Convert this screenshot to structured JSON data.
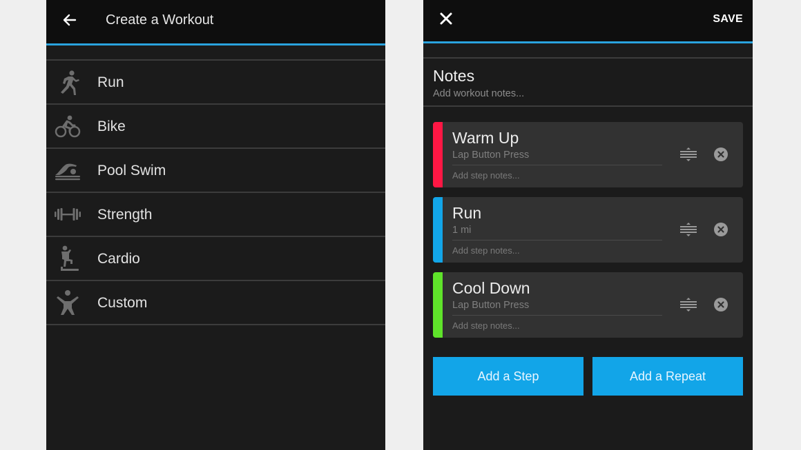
{
  "colors": {
    "accent": "#2aa3de",
    "button": "#12a5e8",
    "step_warmup": "#ff1744",
    "step_run": "#12a5e8",
    "step_cooldown": "#5fe32a"
  },
  "left_screen": {
    "header": {
      "back_icon": "arrow-left-icon",
      "title": "Create a Workout"
    },
    "items": [
      {
        "label": "Run",
        "icon": "runner-icon"
      },
      {
        "label": "Bike",
        "icon": "cyclist-icon"
      },
      {
        "label": "Pool Swim",
        "icon": "swimmer-icon"
      },
      {
        "label": "Strength",
        "icon": "dumbbell-icon"
      },
      {
        "label": "Cardio",
        "icon": "stair-climber-icon"
      },
      {
        "label": "Custom",
        "icon": "person-arms-up-icon"
      }
    ]
  },
  "right_screen": {
    "header": {
      "close_icon": "close-icon",
      "save_label": "SAVE"
    },
    "notes": {
      "title": "Notes",
      "placeholder": "Add workout notes..."
    },
    "steps": [
      {
        "name": "Warm Up",
        "duration": "Lap Button Press",
        "notes_placeholder": "Add step notes...",
        "color": "#ff1744"
      },
      {
        "name": "Run",
        "duration": "1 mi",
        "notes_placeholder": "Add step notes...",
        "color": "#12a5e8"
      },
      {
        "name": "Cool Down",
        "duration": "Lap Button Press",
        "notes_placeholder": "Add step notes...",
        "color": "#5fe32a"
      }
    ],
    "buttons": {
      "add_step": "Add a Step",
      "add_repeat": "Add a Repeat"
    }
  }
}
